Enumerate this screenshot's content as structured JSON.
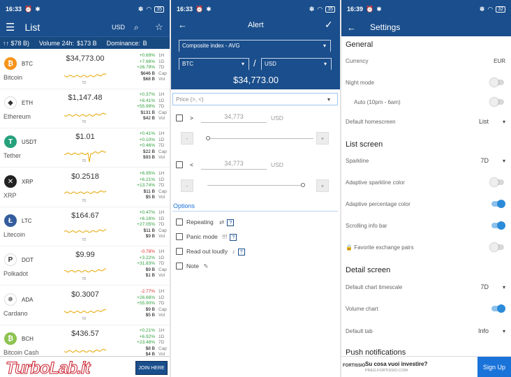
{
  "p1": {
    "status": {
      "time": "16:33",
      "battery": "35"
    },
    "title": "List",
    "currency": "USD",
    "ticker": [
      "↑↑ $78 B)",
      "Volume 24h:",
      "$173 B",
      "Dominance:",
      "B"
    ],
    "timeframe": "7D",
    "coins": [
      {
        "sym": "BTC",
        "name": "Bitcoin",
        "price": "$34,773.00",
        "c1": "+0.69%",
        "c2": "+7.66%",
        "c3": "+26.79%",
        "cap": "$646 B",
        "vol": "$68 B",
        "color": "#f7931a",
        "glyph": "₿"
      },
      {
        "sym": "ETH",
        "name": "Ethereum",
        "price": "$1,147.48",
        "c1": "+0.37%",
        "c2": "+8.41%",
        "c3": "+55.99%",
        "cap": "$131 B",
        "vol": "$42 B",
        "color": "#ffffff",
        "glyph": "◆"
      },
      {
        "sym": "USDT",
        "name": "Tether",
        "price": "$1.01",
        "c1": "+0.41%",
        "c2": "+0.10%",
        "c3": "+0.46%",
        "cap": "$22 B",
        "vol": "$93 B",
        "color": "#26a17b",
        "glyph": "T"
      },
      {
        "sym": "XRP",
        "name": "XRP",
        "price": "$0.2518",
        "c1": "+6.95%",
        "c2": "+6.21%",
        "c3": "+13.74%",
        "cap": "$11 B",
        "vol": "$5 B",
        "color": "#222222",
        "glyph": "✕"
      },
      {
        "sym": "LTC",
        "name": "Litecoin",
        "price": "$164.67",
        "c1": "+0.47%",
        "c2": "+6.16%",
        "c3": "+27.05%",
        "cap": "$11 B",
        "vol": "$9 B",
        "color": "#345d9d",
        "glyph": "Ł"
      },
      {
        "sym": "DOT",
        "name": "Polkadot",
        "price": "$9.99",
        "c1": "-0.78%",
        "c2": "+3.22%",
        "c3": "+31.83%",
        "cap": "$9 B",
        "vol": "$1 B",
        "color": "#ffffff",
        "glyph": "P"
      },
      {
        "sym": "ADA",
        "name": "Cardano",
        "price": "$0.3007",
        "c1": "-2.77%",
        "c2": "+26.66%",
        "c3": "+55.90%",
        "cap": "$9 B",
        "vol": "$5 B",
        "color": "#ffffff",
        "glyph": "✵"
      },
      {
        "sym": "BCH",
        "name": "Bitcoin Cash",
        "price": "$436.57",
        "c1": "+0.21%",
        "c2": "+6.92%",
        "c3": "+23.48%",
        "cap": "$8 B",
        "vol": "$4 B",
        "color": "#8dc351",
        "glyph": "₿"
      }
    ],
    "keys": [
      "1H",
      "1D",
      "7D",
      "Cap",
      "Vol"
    ],
    "ad": {
      "brand": "TurboLab.it",
      "join": "JOIN HERE"
    }
  },
  "p2": {
    "status": {
      "time": "16:33",
      "battery": "35"
    },
    "title": "Alert",
    "index": "Composite index - AVG",
    "from": "BTC",
    "to": "USD",
    "slash": "/",
    "price": "$34,773.00",
    "condition": "Price (>, <)",
    "above": {
      "op": ">",
      "value": "34,773",
      "unit": "USD"
    },
    "below": {
      "op": "<",
      "value": "34,773",
      "unit": "USD"
    },
    "minus": "-",
    "plus": "+",
    "options_title": "Options",
    "options": [
      "Repeating",
      "Panic mode",
      "Read out loudly",
      "Note"
    ],
    "help": "?"
  },
  "p3": {
    "status": {
      "time": "16:39",
      "battery": "32"
    },
    "title": "Settings",
    "general": "General",
    "currency_lbl": "Currency",
    "currency_val": "EUR",
    "night": "Night mode",
    "auto": "Auto (10pm - 6am)",
    "home_lbl": "Default homescreen",
    "home_val": "List",
    "list_screen": "List screen",
    "spark_lbl": "Sparkline",
    "spark_val": "7D",
    "adaptive_spark": "Adaptive sparkline color",
    "adaptive_pct": "Adaptive percentage color",
    "scrolling": "Scrolling info bar",
    "fav": "Favorite exchange pairs",
    "detail": "Detail screen",
    "chart_ts_lbl": "Default chart timescale",
    "chart_ts_val": "7D",
    "volume": "Volume chart",
    "tab_lbl": "Default tab",
    "tab_val": "Info",
    "push": "Push notifications",
    "ad": {
      "logo": "FORTISSIO",
      "t1": "Su cosa vuoi investire?",
      "t2": "PREG.FORTISSIO.COM",
      "btn": "Sign Up"
    }
  }
}
